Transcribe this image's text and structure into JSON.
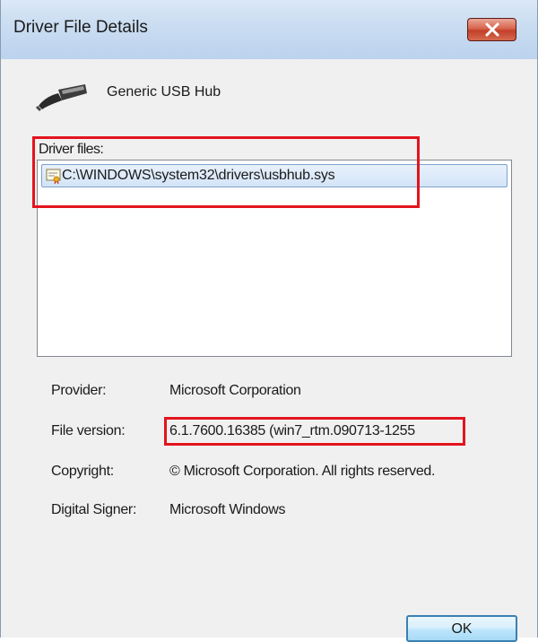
{
  "window": {
    "title": "Driver File Details",
    "close_icon": "close-x-icon"
  },
  "device": {
    "icon": "usb-plug-icon",
    "name": "Generic USB Hub"
  },
  "driver_files": {
    "label": "Driver files:",
    "items": [
      {
        "icon": "signed-certificate-icon",
        "path": "C:\\WINDOWS\\system32\\drivers\\usbhub.sys",
        "selected": true
      }
    ]
  },
  "properties": {
    "provider_label": "Provider:",
    "provider_value": "Microsoft Corporation",
    "file_version_label": "File version:",
    "file_version_value": "6.1.7600.16385 (win7_rtm.090713-1255",
    "copyright_label": "Copyright:",
    "copyright_value": "© Microsoft Corporation. All rights reserved.",
    "digital_signer_label": "Digital Signer:",
    "digital_signer_value": "Microsoft Windows"
  },
  "buttons": {
    "ok_label": "OK"
  },
  "colors": {
    "highlight": "#e3141d",
    "selection_border": "#7da2ce",
    "close_button": "#c94a33",
    "ok_button_border": "#3c7fb1"
  }
}
